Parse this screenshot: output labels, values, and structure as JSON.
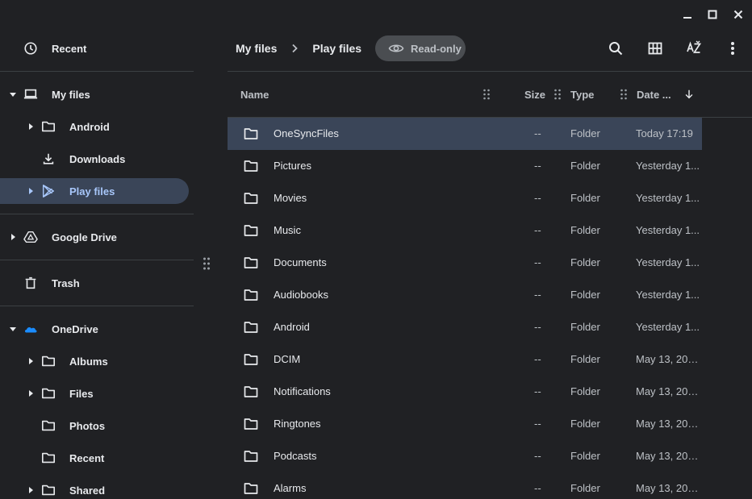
{
  "sidebar": {
    "recent": "Recent",
    "my_files": "My files",
    "android": "Android",
    "downloads": "Downloads",
    "play_files": "Play files",
    "google_drive": "Google Drive",
    "trash": "Trash",
    "onedrive": "OneDrive",
    "albums": "Albums",
    "files": "Files",
    "photos": "Photos",
    "od_recent": "Recent",
    "shared": "Shared"
  },
  "header": {
    "breadcrumb": [
      "My files",
      "Play files"
    ],
    "readonly": "Read-only"
  },
  "columns": {
    "name": "Name",
    "size": "Size",
    "type": "Type",
    "date": "Date ..."
  },
  "rows": [
    {
      "name": "OneSyncFiles",
      "size": "--",
      "type": "Folder",
      "date": "Today 17:19"
    },
    {
      "name": "Pictures",
      "size": "--",
      "type": "Folder",
      "date": "Yesterday 1..."
    },
    {
      "name": "Movies",
      "size": "--",
      "type": "Folder",
      "date": "Yesterday 1..."
    },
    {
      "name": "Music",
      "size": "--",
      "type": "Folder",
      "date": "Yesterday 1..."
    },
    {
      "name": "Documents",
      "size": "--",
      "type": "Folder",
      "date": "Yesterday 1..."
    },
    {
      "name": "Audiobooks",
      "size": "--",
      "type": "Folder",
      "date": "Yesterday 1..."
    },
    {
      "name": "Android",
      "size": "--",
      "type": "Folder",
      "date": "Yesterday 1..."
    },
    {
      "name": "DCIM",
      "size": "--",
      "type": "Folder",
      "date": "May 13, 202..."
    },
    {
      "name": "Notifications",
      "size": "--",
      "type": "Folder",
      "date": "May 13, 202..."
    },
    {
      "name": "Ringtones",
      "size": "--",
      "type": "Folder",
      "date": "May 13, 202..."
    },
    {
      "name": "Podcasts",
      "size": "--",
      "type": "Folder",
      "date": "May 13, 202..."
    },
    {
      "name": "Alarms",
      "size": "--",
      "type": "Folder",
      "date": "May 13, 202..."
    }
  ],
  "colors": {
    "background": "#202124",
    "selected": "#3a4558",
    "selected_text": "#a8c7fa",
    "onedrive": "#1a8cff"
  }
}
